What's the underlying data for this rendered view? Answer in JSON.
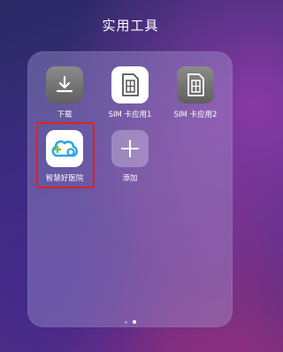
{
  "folder": {
    "title": "实用工具",
    "apps": [
      {
        "label": "下载",
        "icon": "download-icon"
      },
      {
        "label": "SIM 卡应用1",
        "icon": "sim-card-icon"
      },
      {
        "label": "SIM 卡应用2",
        "icon": "sim-card-icon"
      },
      {
        "label": "智慧好医院",
        "icon": "health-cloud-icon"
      },
      {
        "label": "添加",
        "icon": "plus-icon"
      }
    ],
    "page_indicator": {
      "pages": 2,
      "current": 2
    }
  },
  "colors": {
    "highlight_border": "#e02020",
    "health_icon_blue": "#29a6e6",
    "health_icon_green": "#7bc34b"
  }
}
